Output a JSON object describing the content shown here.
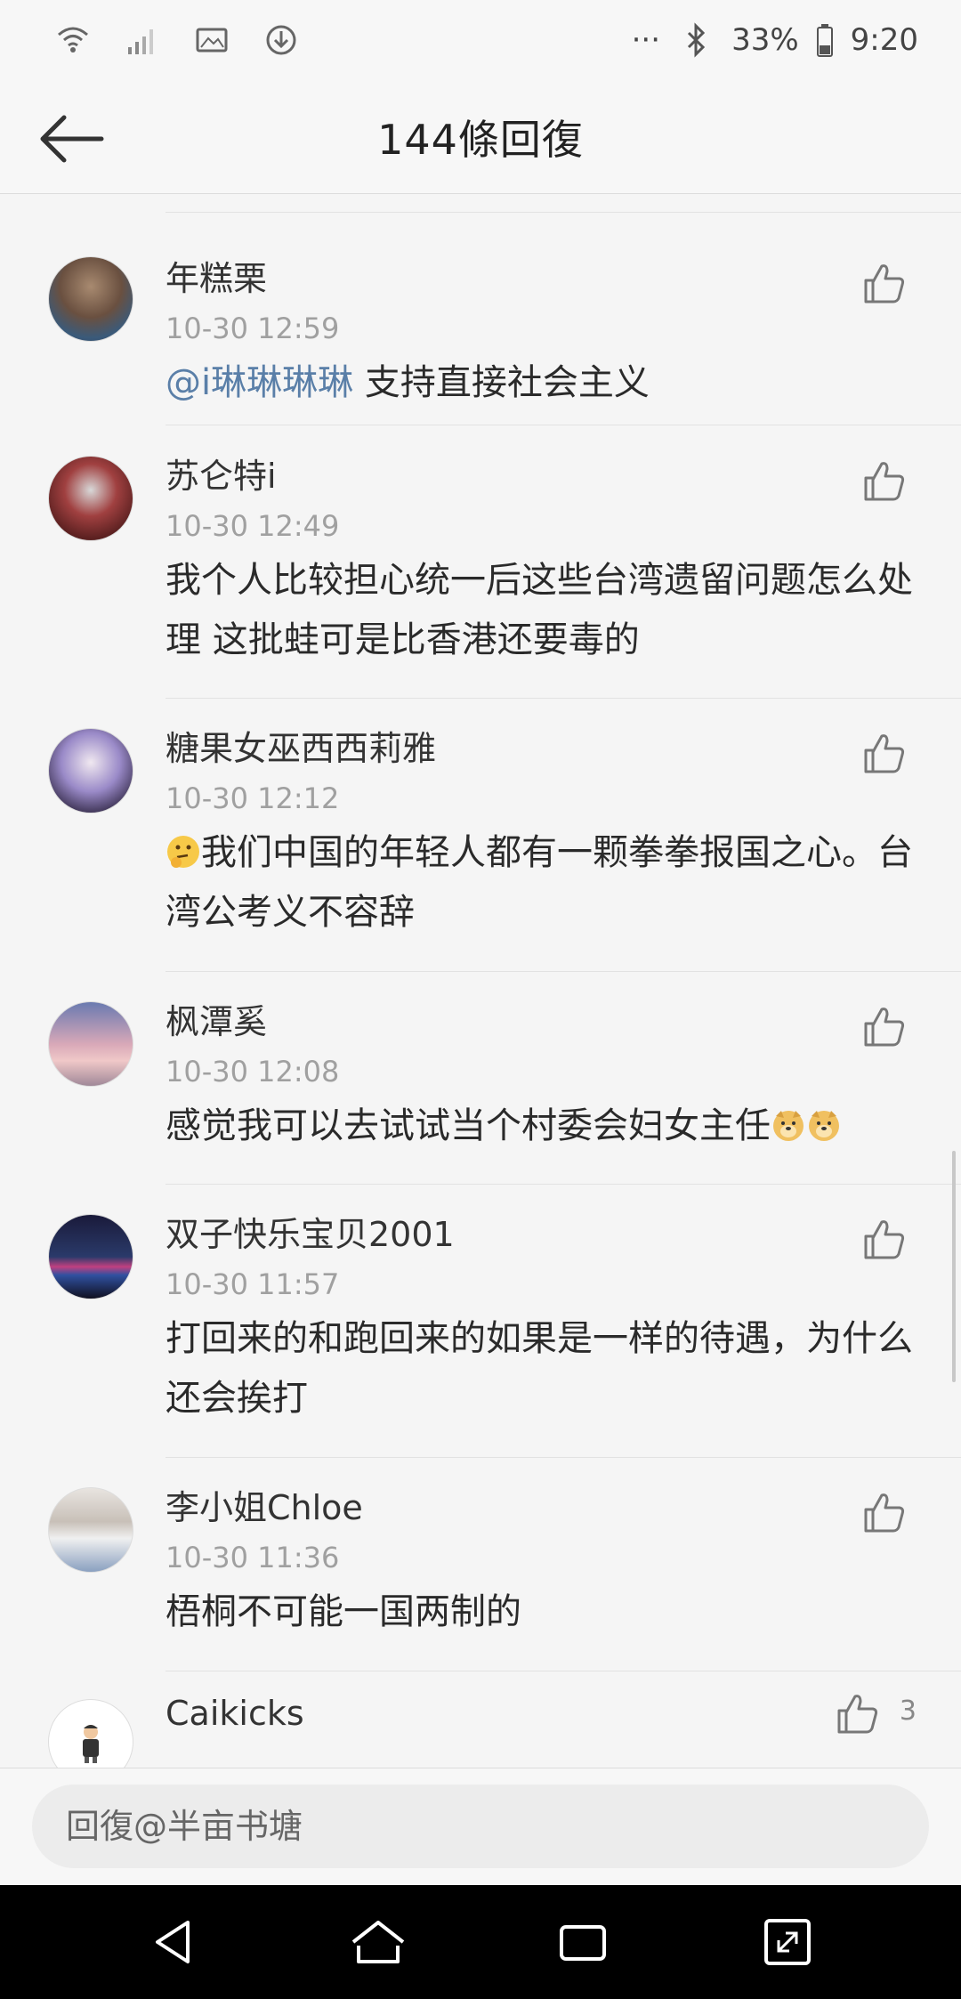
{
  "status_bar": {
    "dots": "···",
    "battery": "33%",
    "time": "9:20"
  },
  "header": {
    "title": "144條回復"
  },
  "comments": [
    {
      "username": "年糕栗",
      "time": "10-30 12:59",
      "mention": "@i琳琳琳琳",
      "text": " 支持直接社会主义",
      "avatar_color": "#8a6b55"
    },
    {
      "username": "苏仑特i",
      "time": "10-30 12:49",
      "text": "我个人比较担心统一后这些台湾遗留问题怎么处理 这批蛙可是比香港还要毒的",
      "avatar_color": "#7a3a3a"
    },
    {
      "username": "糖果女巫西西莉雅",
      "time": "10-30 12:12",
      "text": "我们中国的年轻人都有一颗拳拳报国之心。台湾公考义不容辞",
      "avatar_color": "#b8b0d8"
    },
    {
      "username": "枫潭奚",
      "time": "10-30 12:08",
      "text": "感觉我可以去试试当个村委会妇女主任",
      "avatar_color": "#d9a0a8"
    },
    {
      "username": "双子快乐宝贝2001",
      "time": "10-30 11:57",
      "text": "打回来的和跑回来的如果是一样的待遇，为什么还会挨打",
      "avatar_color": "#1c2a4a"
    },
    {
      "username": "李小姐Chloe",
      "time": "10-30 11:36",
      "text": "梧桐不可能一国两制的",
      "avatar_color": "#c8c0b8"
    },
    {
      "username": "Caikicks",
      "like_count": "3",
      "avatar_color": "#ffffff"
    }
  ],
  "reply": {
    "placeholder": "回復@半亩书塘"
  },
  "icons": {
    "back": "arrow-left-icon",
    "like": "thumbs-up-icon",
    "nav_back": "triangle-back-icon",
    "nav_home": "home-icon",
    "nav_recent": "recent-apps-icon",
    "nav_expand": "expand-icon"
  }
}
